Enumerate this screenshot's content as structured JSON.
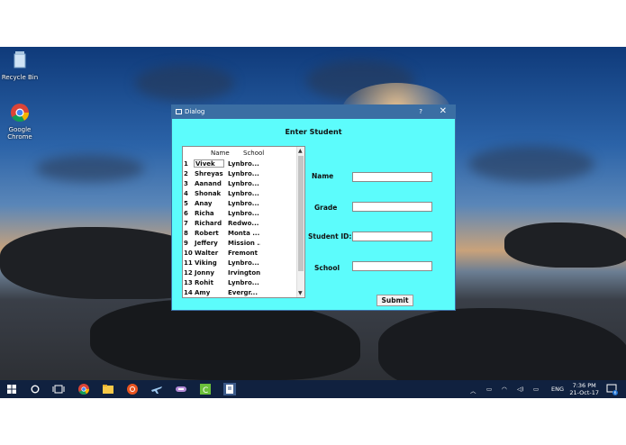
{
  "desktop": {
    "icons": [
      {
        "label": "Recycle Bin"
      },
      {
        "label": "Google Chrome"
      }
    ]
  },
  "dialog": {
    "title": "Dialog",
    "help": "?",
    "close": "✕",
    "heading": "Enter Student",
    "table": {
      "columns": [
        "Name",
        "School"
      ],
      "rows": [
        {
          "num": "1",
          "name": "Vivek",
          "school": "Lynbro..."
        },
        {
          "num": "2",
          "name": "Shreyas",
          "school": "Lynbro..."
        },
        {
          "num": "3",
          "name": "Aanand",
          "school": "Lynbro..."
        },
        {
          "num": "4",
          "name": "Shonak",
          "school": "Lynbro..."
        },
        {
          "num": "5",
          "name": "Anay",
          "school": "Lynbro..."
        },
        {
          "num": "6",
          "name": "Richa",
          "school": "Lynbro..."
        },
        {
          "num": "7",
          "name": "Richard",
          "school": "Redwo..."
        },
        {
          "num": "8",
          "name": "Robert",
          "school": "Monta ..."
        },
        {
          "num": "9",
          "name": "Jeffery",
          "school": "Mission ..."
        },
        {
          "num": "10",
          "name": "Walter",
          "school": "Fremont"
        },
        {
          "num": "11",
          "name": "Viking",
          "school": "Lynbro..."
        },
        {
          "num": "12",
          "name": "Jonny",
          "school": "Irvington"
        },
        {
          "num": "13",
          "name": "Rohit",
          "school": "Lynbro..."
        },
        {
          "num": "14",
          "name": "Amy",
          "school": "Evergr..."
        }
      ]
    },
    "fields": [
      {
        "label": "Name",
        "value": ""
      },
      {
        "label": "Grade",
        "value": ""
      },
      {
        "label": "Student ID:",
        "value": ""
      },
      {
        "label": "School",
        "value": ""
      }
    ],
    "submit_label": "Submit",
    "colors": {
      "background": "#5cfcfc",
      "titlebar": "#3b6ea3"
    }
  },
  "taskbar": {
    "apps": [
      "start-icon",
      "search-icon",
      "task-view-icon",
      "chrome-icon",
      "file-explorer-icon",
      "ubuntu-icon",
      "airplane-icon",
      "media-icon",
      "camtasia-icon",
      "notepad-icon"
    ],
    "language": "ENG",
    "time": "7:36 PM",
    "date": "21-Oct-17",
    "notification_count": "6"
  }
}
